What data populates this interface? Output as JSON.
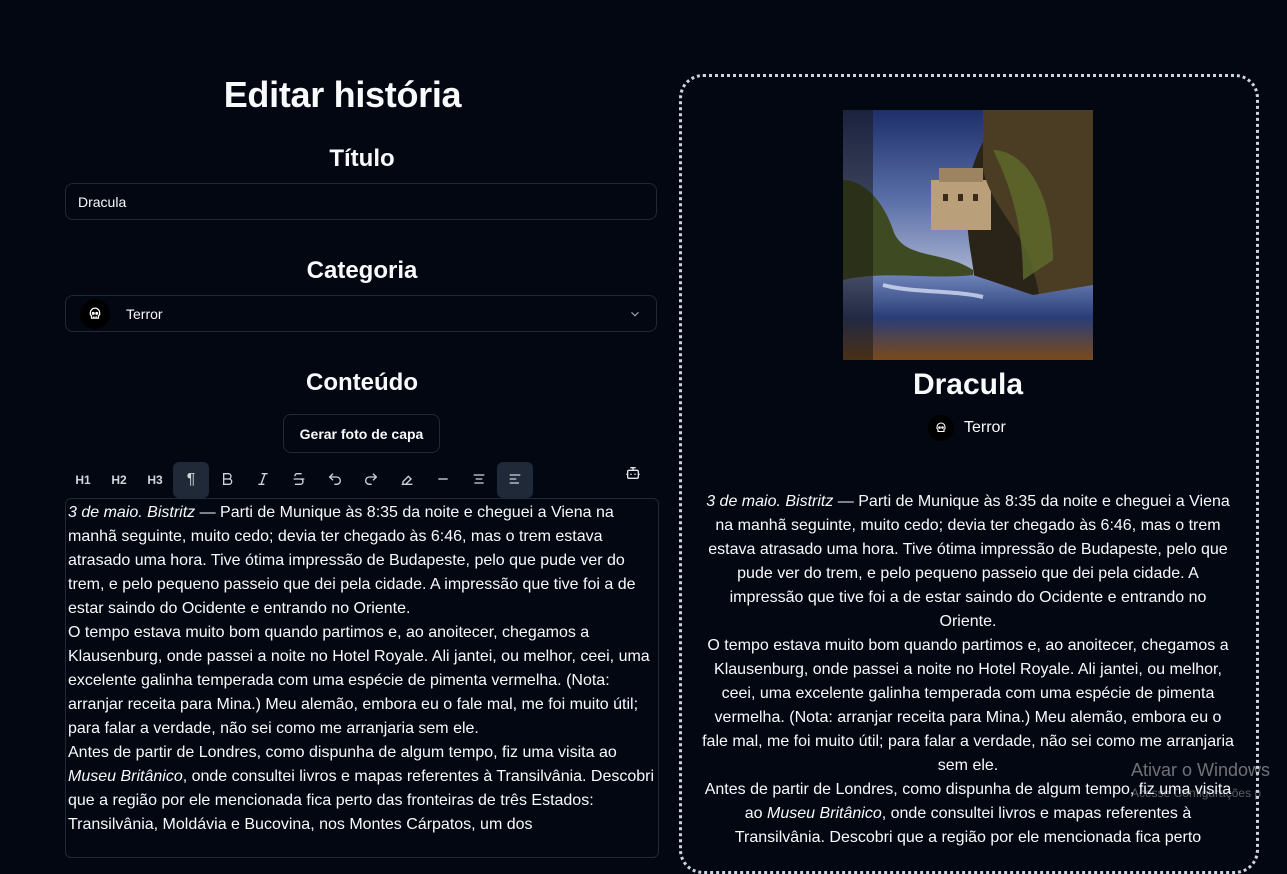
{
  "page_title": "Editar história",
  "title_section": {
    "label": "Título",
    "value": "Dracula"
  },
  "category_section": {
    "label": "Categoria",
    "selected": "Terror",
    "icon": "skull-icon"
  },
  "content_section": {
    "label": "Conteúdo",
    "generate_cover_label": "Gerar foto de capa"
  },
  "toolbar": {
    "h1": "H1",
    "h2": "H2",
    "h3": "H3",
    "icons": [
      "paragraph-icon",
      "bold-icon",
      "italic-icon",
      "strikethrough-icon",
      "undo-icon",
      "redo-icon",
      "clear-format-icon",
      "horizontal-rule-icon",
      "align-center-icon",
      "align-left-icon",
      "bot-icon"
    ],
    "active": [
      "paragraph",
      "align-left"
    ]
  },
  "editor": {
    "p1_italic": "3 de maio. Bistritz",
    "p1_rest": " — Parti de Munique às 8:35 da noite e cheguei a Viena na manhã seguinte, muito cedo; devia ter chegado às 6:46, mas o trem estava atrasado uma hora. Tive ótima impressão de Budapeste, pelo que pude ver do trem, e pelo pequeno passeio que dei pela cidade. A impressão que tive foi a de estar saindo do Ocidente e entrando no Oriente.",
    "p2": "O tempo estava muito bom quando partimos e, ao anoitecer, chegamos a Klausenburg, onde passei a noite no Hotel Royale. Ali jantei, ou melhor, ceei, uma excelente galinha temperada com uma espécie de pimenta vermelha. (Nota: arranjar receita para Mina.) Meu alemão, embora eu o fale mal, me foi muito útil; para falar a verdade, não sei como me arranjaria sem ele.",
    "p3_a": "Antes de partir de Londres, como dispunha de algum tempo, fiz uma visita ao ",
    "p3_italic": "Museu Britânico",
    "p3_b": ", onde consultei livros e mapas referentes à Transilvânia. Descobri que a região por ele mencionada fica perto das fronteiras de três Estados: Transilvânia, Moldávia e Bucovina, nos Montes Cárpatos, um dos"
  },
  "preview": {
    "title": "Dracula",
    "category": "Terror",
    "cover_alt_description": "",
    "p3_b": ", onde consultei livros e mapas referentes à Transilvânia. Descobri que a região por ele mencionada fica perto"
  },
  "os_watermark": {
    "line1": "Ativar o Windows",
    "line2": "Acesse Configurações p"
  }
}
